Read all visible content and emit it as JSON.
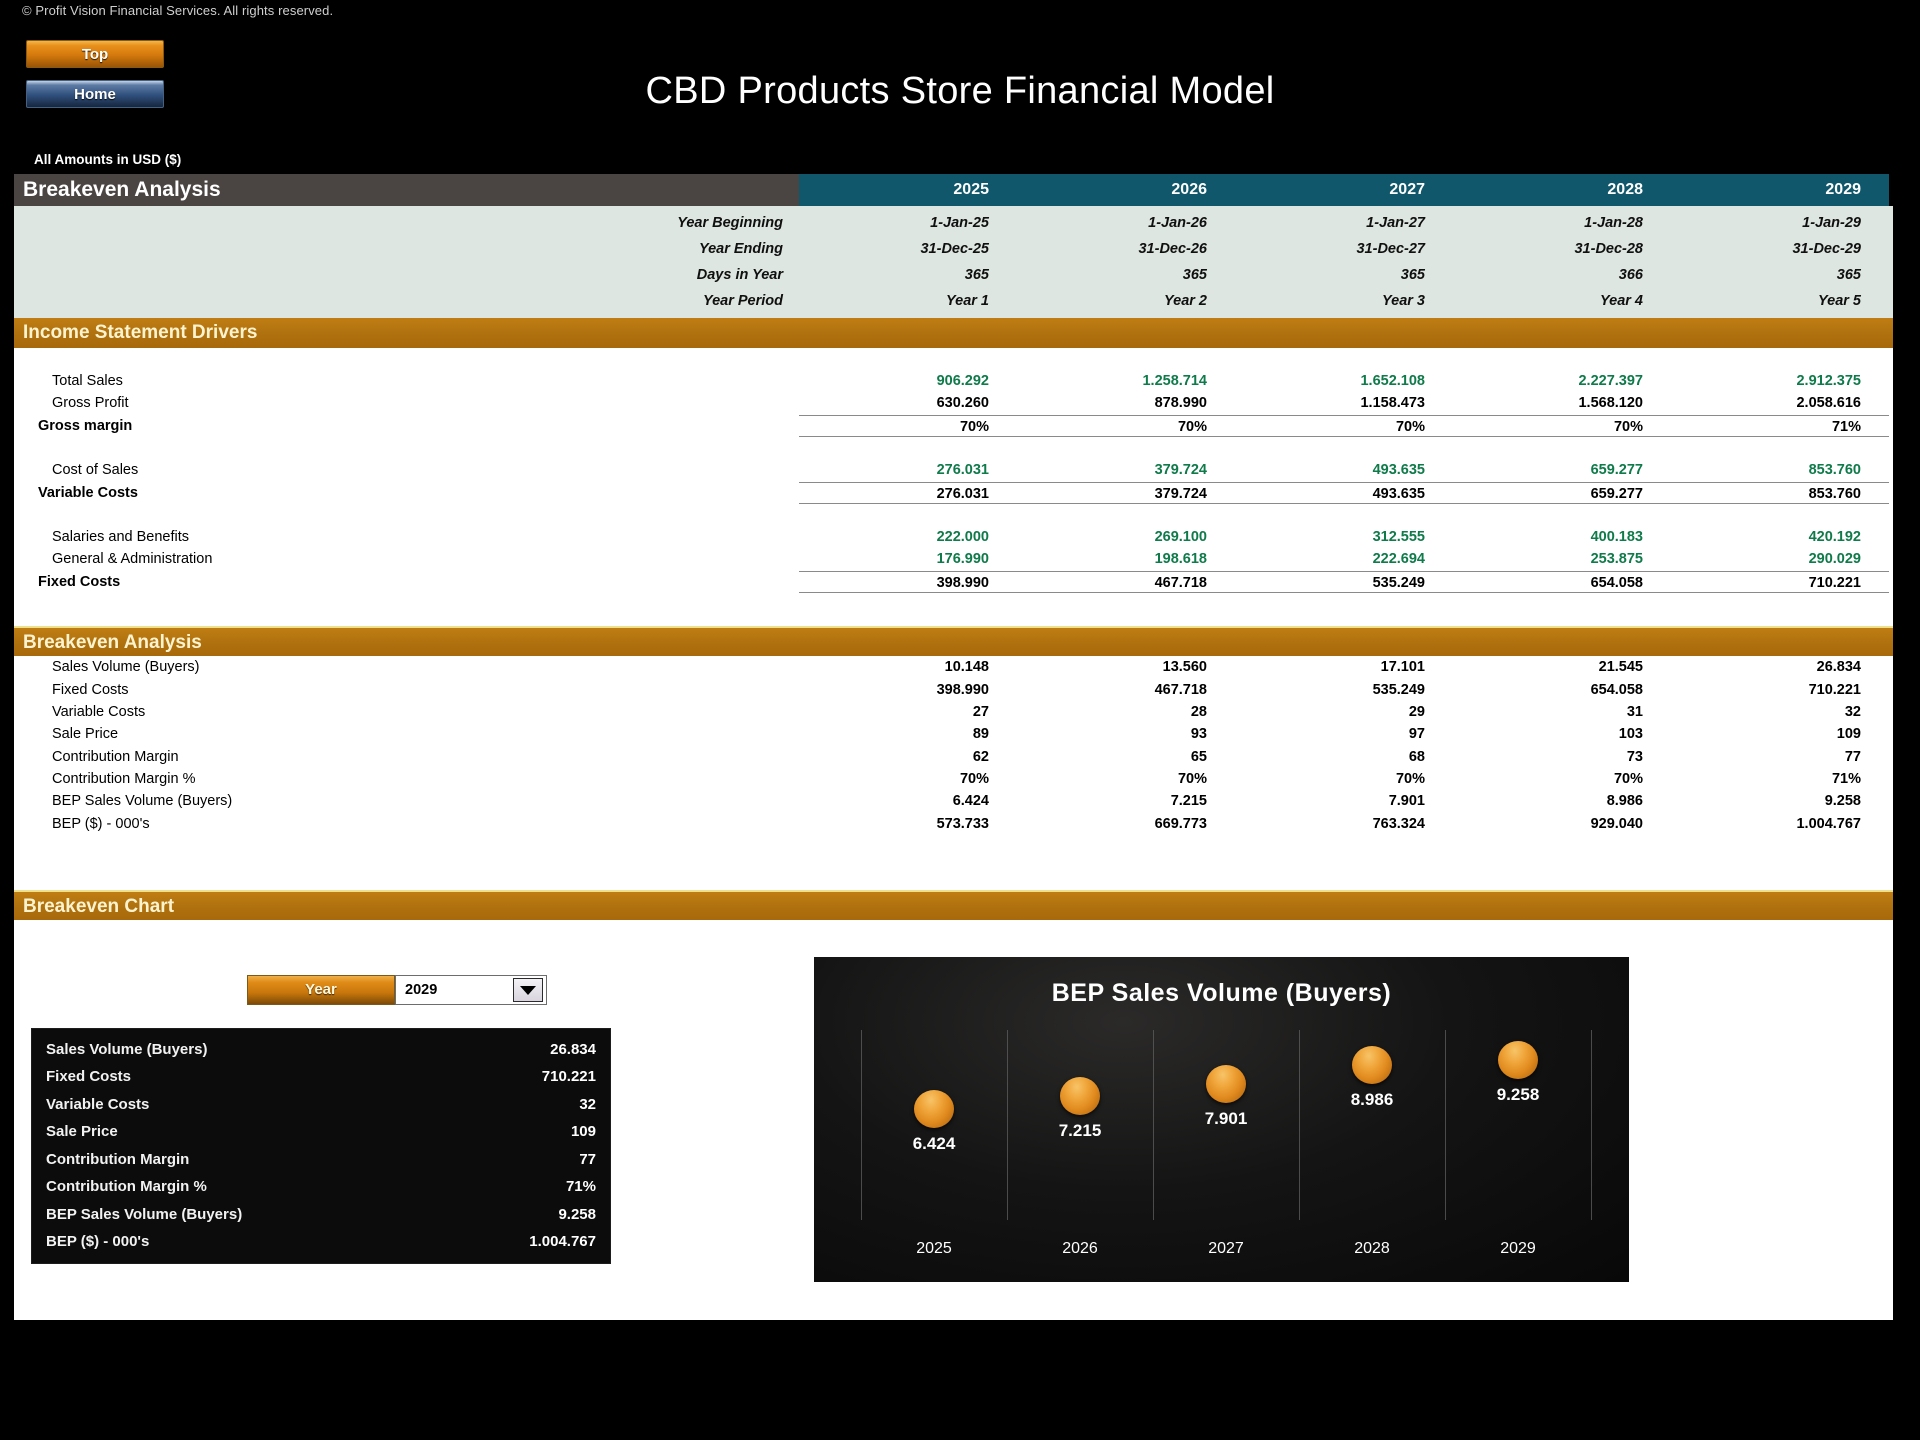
{
  "header": {
    "copyright": "© Profit Vision Financial Services. All rights reserved.",
    "nav": [
      {
        "label": "Top",
        "name": "top-button"
      },
      {
        "label": "Home",
        "name": "home-button"
      }
    ],
    "title": "CBD Products Store Financial Model",
    "units_note": "All Amounts in  USD ($)"
  },
  "sheet": {
    "band_title": "Breakeven Analysis",
    "years": [
      "2025",
      "2026",
      "2027",
      "2028",
      "2029"
    ],
    "dates": [
      {
        "label": "Year Beginning",
        "values": [
          "1-Jan-25",
          "1-Jan-26",
          "1-Jan-27",
          "1-Jan-28",
          "1-Jan-29"
        ]
      },
      {
        "label": "Year Ending",
        "values": [
          "31-Dec-25",
          "31-Dec-26",
          "31-Dec-27",
          "31-Dec-28",
          "31-Dec-29"
        ]
      },
      {
        "label": "Days in Year",
        "values": [
          "365",
          "365",
          "365",
          "366",
          "365"
        ]
      },
      {
        "label": "Year Period",
        "values": [
          "Year 1",
          "Year 2",
          "Year 3",
          "Year 4",
          "Year 5"
        ]
      }
    ],
    "section_income": {
      "title": "Income Statement Drivers",
      "rows": [
        {
          "label": "Total Sales",
          "bold": false,
          "green": true,
          "rule": "none",
          "values": [
            "906.292",
            "1.258.714",
            "1.652.108",
            "2.227.397",
            "2.912.375"
          ]
        },
        {
          "label": "Gross Profit",
          "bold": false,
          "green": false,
          "rule": "none",
          "values": [
            "630.260",
            "878.990",
            "1.158.473",
            "1.568.120",
            "2.058.616"
          ]
        },
        {
          "label": "Gross margin",
          "bold": true,
          "green": false,
          "rule": "double",
          "values": [
            "70%",
            "70%",
            "70%",
            "70%",
            "71%"
          ]
        },
        {
          "label": "Cost of Sales",
          "bold": false,
          "green": true,
          "rule": "none",
          "values": [
            "276.031",
            "379.724",
            "493.635",
            "659.277",
            "853.760"
          ]
        },
        {
          "label": "Variable Costs",
          "bold": true,
          "green": false,
          "rule": "double",
          "values": [
            "276.031",
            "379.724",
            "493.635",
            "659.277",
            "853.760"
          ]
        },
        {
          "label": "Salaries and Benefits",
          "bold": false,
          "green": true,
          "rule": "none",
          "values": [
            "222.000",
            "269.100",
            "312.555",
            "400.183",
            "420.192"
          ]
        },
        {
          "label": "General & Administration",
          "bold": false,
          "green": true,
          "rule": "none",
          "values": [
            "176.990",
            "198.618",
            "222.694",
            "253.875",
            "290.029"
          ]
        },
        {
          "label": "Fixed Costs",
          "bold": true,
          "green": false,
          "rule": "double",
          "values": [
            "398.990",
            "467.718",
            "535.249",
            "654.058",
            "710.221"
          ]
        }
      ]
    },
    "section_breakeven": {
      "title": "Breakeven Analysis",
      "rows": [
        {
          "label": "Sales Volume (Buyers)",
          "values": [
            "10.148",
            "13.560",
            "17.101",
            "21.545",
            "26.834"
          ]
        },
        {
          "label": "Fixed Costs",
          "values": [
            "398.990",
            "467.718",
            "535.249",
            "654.058",
            "710.221"
          ]
        },
        {
          "label": "Variable Costs",
          "values": [
            "27",
            "28",
            "29",
            "31",
            "32"
          ]
        },
        {
          "label": "Sale Price",
          "values": [
            "89",
            "93",
            "97",
            "103",
            "109"
          ]
        },
        {
          "label": "Contribution Margin",
          "values": [
            "62",
            "65",
            "68",
            "73",
            "77"
          ]
        },
        {
          "label": "Contribution Margin %",
          "values": [
            "70%",
            "70%",
            "70%",
            "70%",
            "71%"
          ]
        },
        {
          "label": "BEP Sales Volume (Buyers)",
          "values": [
            "6.424",
            "7.215",
            "7.901",
            "8.986",
            "9.258"
          ]
        },
        {
          "label": "BEP ($) - 000's",
          "values": [
            "573.733",
            "669.773",
            "763.324",
            "929.040",
            "1.004.767"
          ]
        }
      ]
    },
    "section_chart": {
      "title": "Breakeven Chart"
    }
  },
  "chart_controls": {
    "year_button_label": "Year",
    "selected_year": "2029",
    "year_options": [
      "2025",
      "2026",
      "2027",
      "2028",
      "2029"
    ]
  },
  "summary_panel": {
    "rows": [
      {
        "key": "Sales Volume (Buyers)",
        "value": "26.834"
      },
      {
        "key": "Fixed Costs",
        "value": "710.221"
      },
      {
        "key": "Variable Costs",
        "value": "32"
      },
      {
        "key": "Sale Price",
        "value": "109"
      },
      {
        "key": "Contribution Margin",
        "value": "77"
      },
      {
        "key": "Contribution Margin %",
        "value": "71%"
      },
      {
        "key": "BEP Sales Volume (Buyers)",
        "value": "9.258"
      },
      {
        "key": "BEP ($) - 000's",
        "value": "1.004.767"
      }
    ]
  },
  "chart_data": {
    "type": "scatter",
    "title": "BEP Sales Volume (Buyers)",
    "xlabel": "",
    "ylabel": "",
    "categories": [
      "2025",
      "2026",
      "2027",
      "2028",
      "2029"
    ],
    "values": [
      6424,
      7215,
      7901,
      8986,
      9258
    ],
    "value_labels": [
      "6.424",
      "7.215",
      "7.901",
      "8.986",
      "9.258"
    ],
    "ylim": [
      0,
      11000
    ],
    "grid": "vertical",
    "legend": "none",
    "marker": "orange-sphere",
    "background": "#111111",
    "accent_color": "#e08a1e"
  },
  "colors": {
    "accent_orange": "#b0720f",
    "header_teal": "#10576b",
    "band_gray": "#4a4543",
    "date_bg": "#dde6e0",
    "input_green": "#0f7a4a",
    "page_bg": "#000000"
  }
}
